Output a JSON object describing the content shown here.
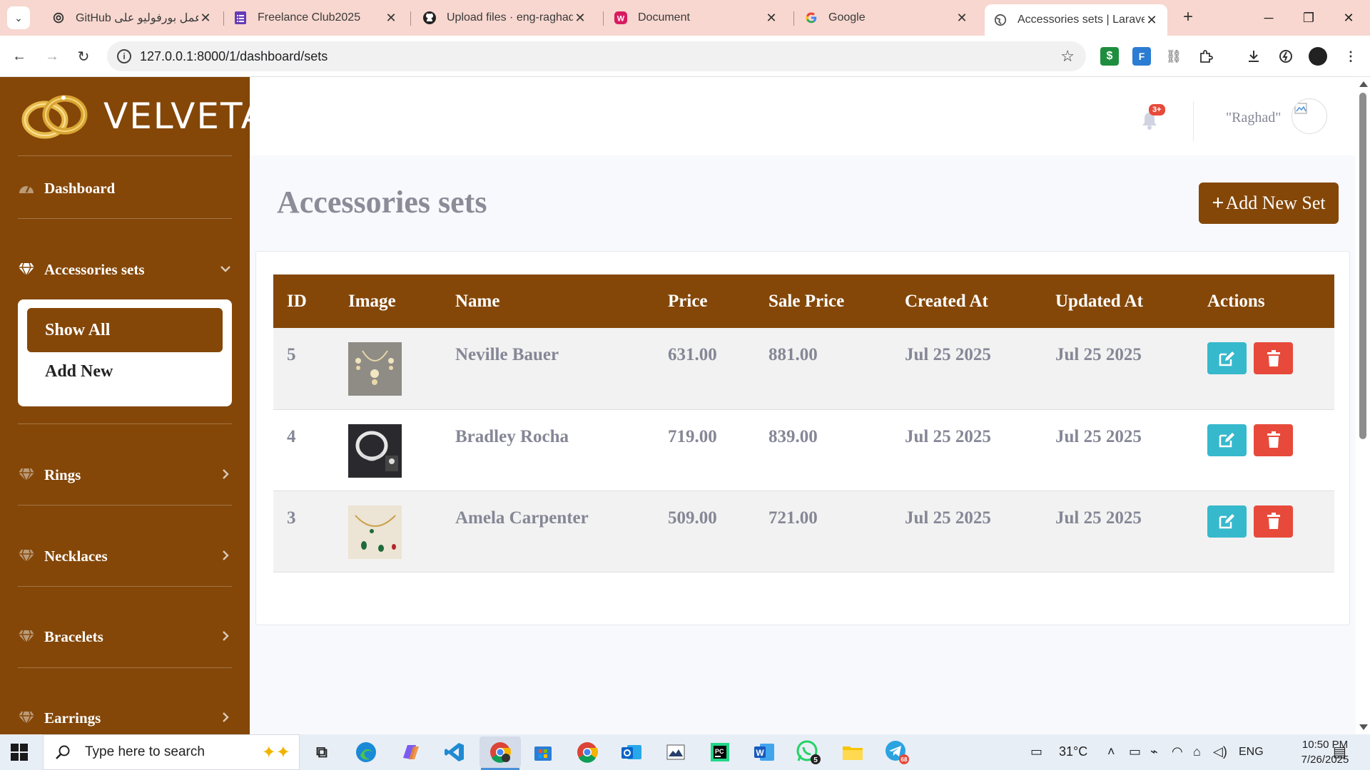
{
  "browser": {
    "tabs": [
      {
        "title": "GitHub عمل بورفوليو على",
        "icon": "openai-icon"
      },
      {
        "title": "Freelance Club2025",
        "icon": "forms-icon"
      },
      {
        "title": "Upload files · eng-raghads",
        "icon": "github-icon"
      },
      {
        "title": "Document",
        "icon": "document-icon"
      },
      {
        "title": "Google",
        "icon": "google-icon"
      },
      {
        "title": "Accessories sets | Laravel",
        "icon": "globe-icon",
        "active": true
      }
    ],
    "new_tab": "+",
    "url": "127.0.0.1:8000/1/dashboard/sets"
  },
  "sidebar": {
    "brand": "VELVETA",
    "items": [
      {
        "label": "Dashboard",
        "icon": "gauge-icon"
      },
      {
        "label": "Accessories sets",
        "icon": "gem-icon",
        "expanded": true
      },
      {
        "label": "Rings",
        "icon": "gem-icon"
      },
      {
        "label": "Necklaces",
        "icon": "gem-icon"
      },
      {
        "label": "Bracelets",
        "icon": "gem-icon"
      },
      {
        "label": "Earrings",
        "icon": "gem-icon"
      }
    ],
    "submenu": {
      "active": "Show All",
      "other": "Add New"
    }
  },
  "topnav": {
    "badge": "3+",
    "username": "\"Raghad\""
  },
  "main": {
    "title": "Accessories sets",
    "add_button": "Add New Set",
    "add_button_icon": "+",
    "table": {
      "headers": [
        "ID",
        "Image",
        "Name",
        "Price",
        "Sale Price",
        "Created At",
        "Updated At",
        "Actions"
      ],
      "rows": [
        {
          "id": "5",
          "name": "Neville Bauer",
          "price": "631.00",
          "sale_price": "881.00",
          "created_at": "Jul 25 2025",
          "updated_at": "Jul 25 2025"
        },
        {
          "id": "4",
          "name": "Bradley Rocha",
          "price": "719.00",
          "sale_price": "839.00",
          "created_at": "Jul 25 2025",
          "updated_at": "Jul 25 2025"
        },
        {
          "id": "3",
          "name": "Amela Carpenter",
          "price": "509.00",
          "sale_price": "721.00",
          "created_at": "Jul 25 2025",
          "updated_at": "Jul 25 2025"
        }
      ]
    }
  },
  "taskbar": {
    "search_placeholder": "Type here to search",
    "weather": "31°C",
    "language": "ENG",
    "time": "10:50 PM",
    "date": "7/26/2025",
    "whatsapp_badge": "5",
    "telegram_badge": "68"
  },
  "colors": {
    "brand": "#844708",
    "edit": "#36b9cc",
    "delete": "#e74a3b",
    "tabbar": "#f7d7cf"
  }
}
